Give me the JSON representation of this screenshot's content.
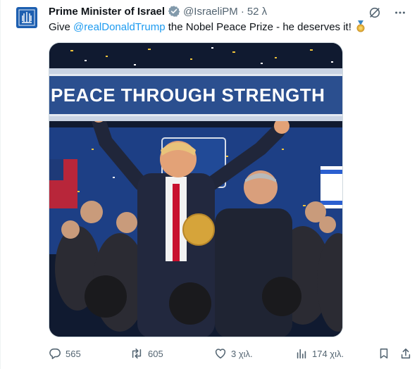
{
  "post": {
    "author_name": "Prime Minister of Israel",
    "handle": "@IsraeliPM",
    "separator": "·",
    "time": "52 λ",
    "text_prefix": "Give ",
    "mention": "@realDonaldTrump",
    "text_suffix": " the Nobel Peace Prize - he deserves it!",
    "emoji_icon": "medal-icon"
  },
  "media": {
    "banner_text": "PEACE THROUGH STRENGTH"
  },
  "actions": {
    "replies": "565",
    "reposts": "605",
    "likes": "3 χιλ.",
    "views": "174 χιλ."
  },
  "colors": {
    "accent": "#1d9bf0",
    "text": "#0f1419",
    "muted": "#536471",
    "badge_gray": "#829aab"
  }
}
